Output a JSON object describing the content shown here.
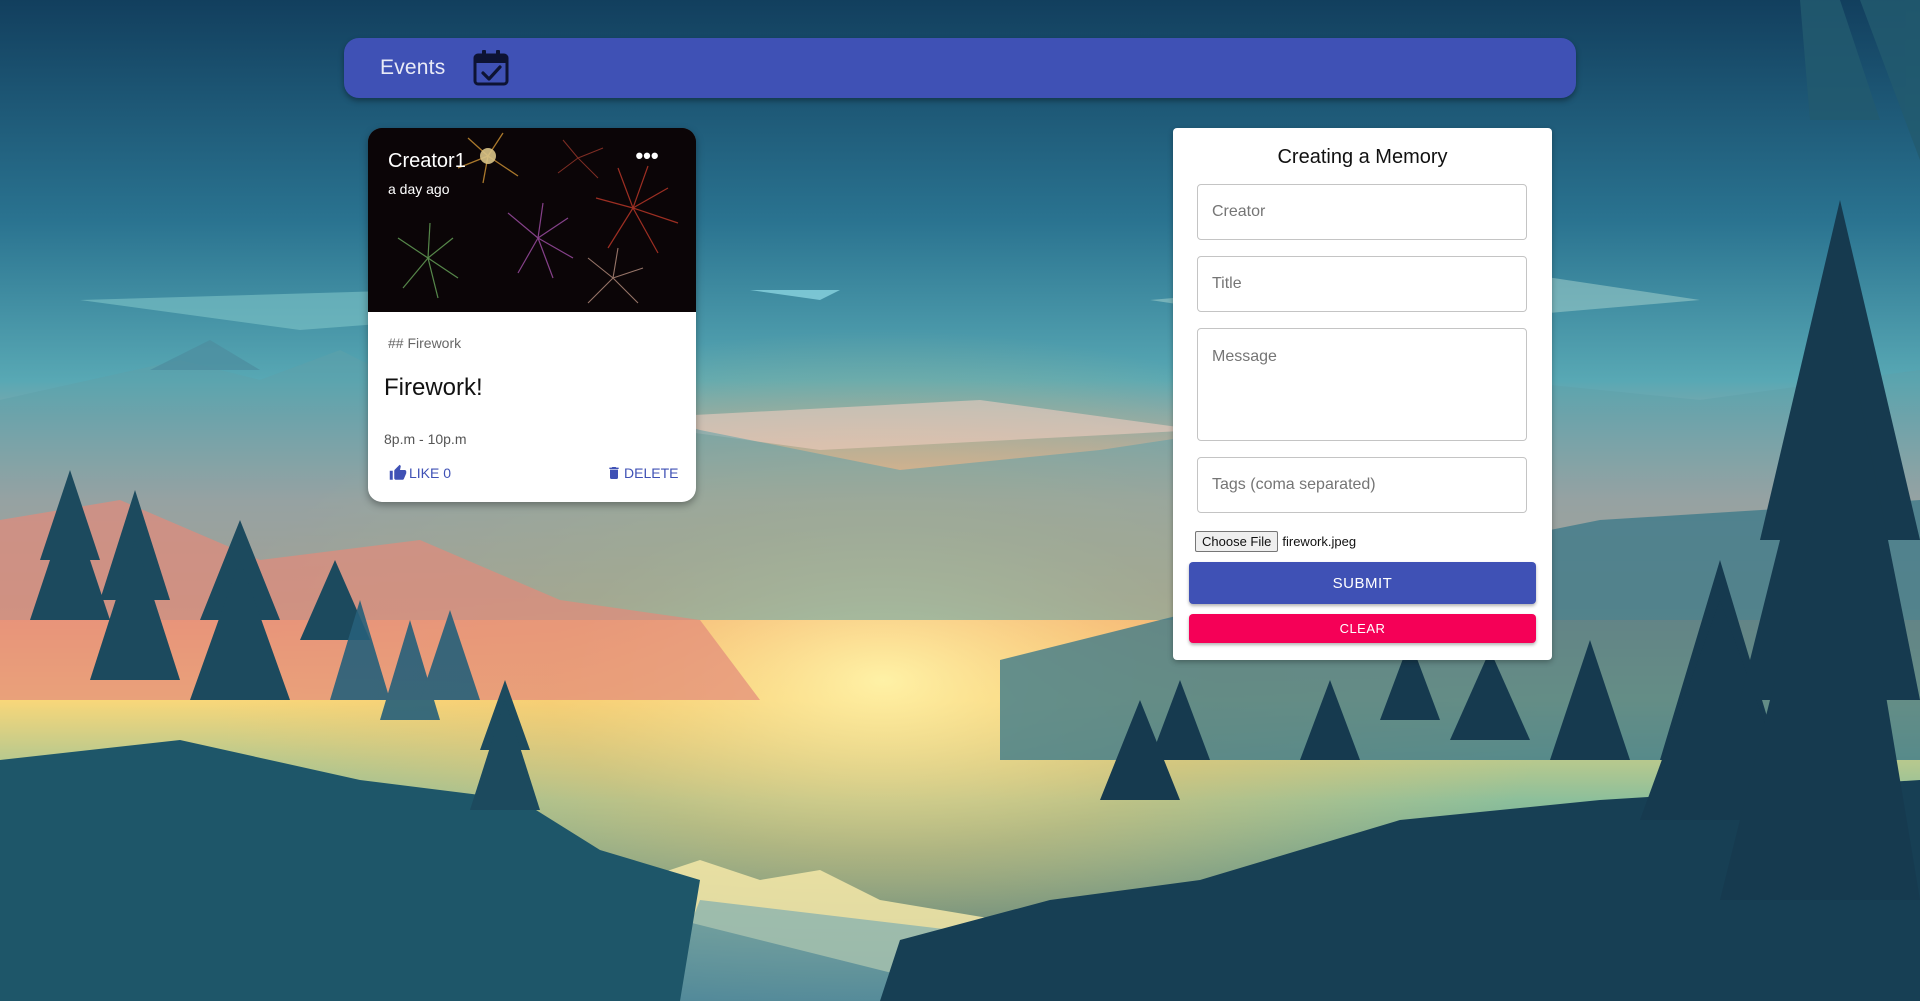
{
  "appbar": {
    "title": "Events",
    "icon": "calendar-check-icon",
    "color": "#3f51b5"
  },
  "post": {
    "creator": "Creator1",
    "time": "a day ago",
    "tags": "## Firework",
    "title": "Firework!",
    "message": "8p.m - 10p.m",
    "like_label": "LIKE 0",
    "delete_label": "DELETE",
    "more_icon": "more-horizontal-icon",
    "media": "fireworks-image"
  },
  "form": {
    "heading": "Creating a Memory",
    "creator_placeholder": "Creator",
    "title_placeholder": "Title",
    "message_placeholder": "Message",
    "tags_placeholder": "Tags (coma separated)",
    "file_button": "Choose File",
    "file_name": "firework.jpeg",
    "submit_label": "SUBMIT",
    "clear_label": "CLEAR",
    "submit_color": "#3f51b5",
    "clear_color": "#f50057"
  },
  "background": "sunset-forest-landscape"
}
